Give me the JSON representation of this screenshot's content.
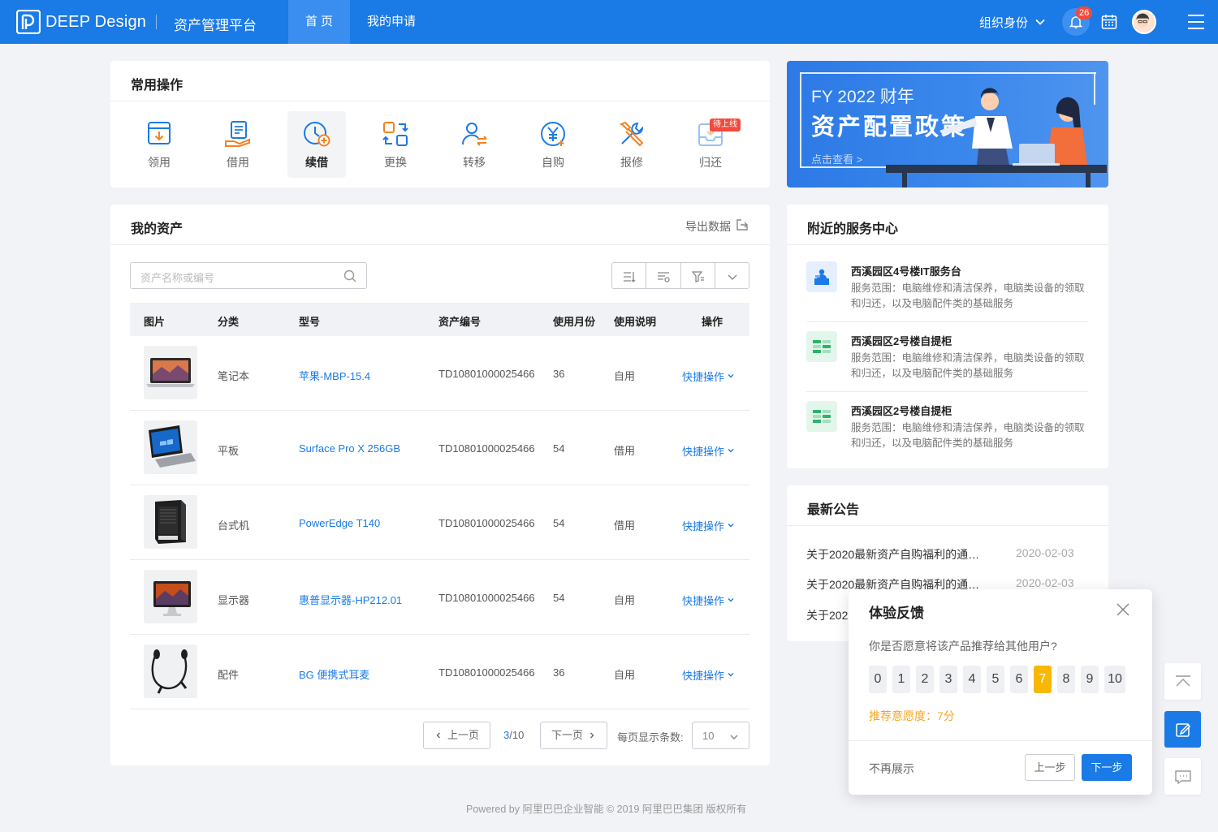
{
  "header": {
    "brand": "DEEP Design",
    "platform": "资产管理平台",
    "nav": [
      {
        "label": "首 页",
        "active": true
      },
      {
        "label": "我的申请",
        "active": false
      }
    ],
    "org_label": "组织身份",
    "notification_count": "26",
    "accent_color": "#1a7ae6"
  },
  "quick_ops": {
    "title": "常用操作",
    "items": [
      {
        "label": "领用",
        "icon": "box-receive-icon"
      },
      {
        "label": "借用",
        "icon": "hand-doc-icon"
      },
      {
        "label": "续借",
        "icon": "clock-plus-icon",
        "active": true
      },
      {
        "label": "更换",
        "icon": "swap-icon"
      },
      {
        "label": "转移",
        "icon": "user-transfer-icon"
      },
      {
        "label": "自购",
        "icon": "yuan-coin-icon"
      },
      {
        "label": "报修",
        "icon": "wrench-icon"
      },
      {
        "label": "归还",
        "icon": "return-tray-icon",
        "tag": "待上线"
      }
    ]
  },
  "banner": {
    "year": "FY 2022 财年",
    "title": "资产配置政策",
    "link": "点击查看 >"
  },
  "assets": {
    "title": "我的资产",
    "export": "导出数据",
    "search_placeholder": "资产名称或编号",
    "columns": [
      "图片",
      "分类",
      "型号",
      "资产编号",
      "使用月份",
      "使用说明",
      "操作"
    ],
    "rows": [
      {
        "category": "笔记本",
        "model": "苹果-MBP-15.4",
        "code": "TD10801000025466",
        "months": "36",
        "usage": "自用",
        "action": "快捷操作",
        "thumb": "laptop"
      },
      {
        "category": "平板",
        "model": "Surface Pro X 256GB",
        "code": "TD10801000025466",
        "months": "54",
        "usage": "借用",
        "action": "快捷操作",
        "thumb": "tablet"
      },
      {
        "category": "台式机",
        "model": "PowerEdge T140",
        "code": "TD10801000025466",
        "months": "54",
        "usage": "借用",
        "action": "快捷操作",
        "thumb": "tower"
      },
      {
        "category": "显示器",
        "model": "惠普显示器-HP212.01",
        "code": "TD10801000025466",
        "months": "54",
        "usage": "自用",
        "action": "快捷操作",
        "thumb": "monitor"
      },
      {
        "category": "配件",
        "model": "BG 便携式耳麦",
        "code": "TD10801000025466",
        "months": "36",
        "usage": "自用",
        "action": "快捷操作",
        "thumb": "earphones"
      }
    ],
    "pager": {
      "prev": "上一页",
      "current": "3",
      "total": "/10",
      "next": "下一页",
      "per_page_label": "每页显示条数:",
      "per_page": "10"
    }
  },
  "service": {
    "title": "附近的服务中心",
    "items": [
      {
        "name": "西溪园区4号楼IT服务台",
        "desc": "服务范围：电脑维修和清洁保养，电脑类设备的领取和归还，以及电脑配件类的基础服务",
        "icon": "service-desk-icon"
      },
      {
        "name": "西溪园区2号楼自提柜",
        "desc": "服务范围：电脑维修和清洁保养，电脑类设备的领取和归还，以及电脑配件类的基础服务",
        "icon": "locker-icon"
      },
      {
        "name": "西溪园区2号楼自提柜",
        "desc": "服务范围：电脑维修和清洁保养，电脑类设备的领取和归还，以及电脑配件类的基础服务",
        "icon": "locker-icon"
      }
    ]
  },
  "notice": {
    "title": "最新公告",
    "items": [
      {
        "text": "关于2020最新资产自购福利的通…",
        "date": "2020-02-03"
      },
      {
        "text": "关于2020最新资产自购福利的通…",
        "date": "2020-02-03"
      },
      {
        "text": "关于202"
      }
    ]
  },
  "feedback": {
    "title": "体验反馈",
    "question": "你是否愿意将该产品推荐给其他用户?",
    "scores": [
      "0",
      "1",
      "2",
      "3",
      "4",
      "5",
      "6",
      "7",
      "8",
      "9",
      "10"
    ],
    "selected": "7",
    "result": "推荐意愿度：7分",
    "skip": "不再展示",
    "prev": "上一步",
    "next": "下一步"
  },
  "footer": "Powered by 阿里巴巴企业智能 © 2019 阿里巴巴集团 版权所有"
}
